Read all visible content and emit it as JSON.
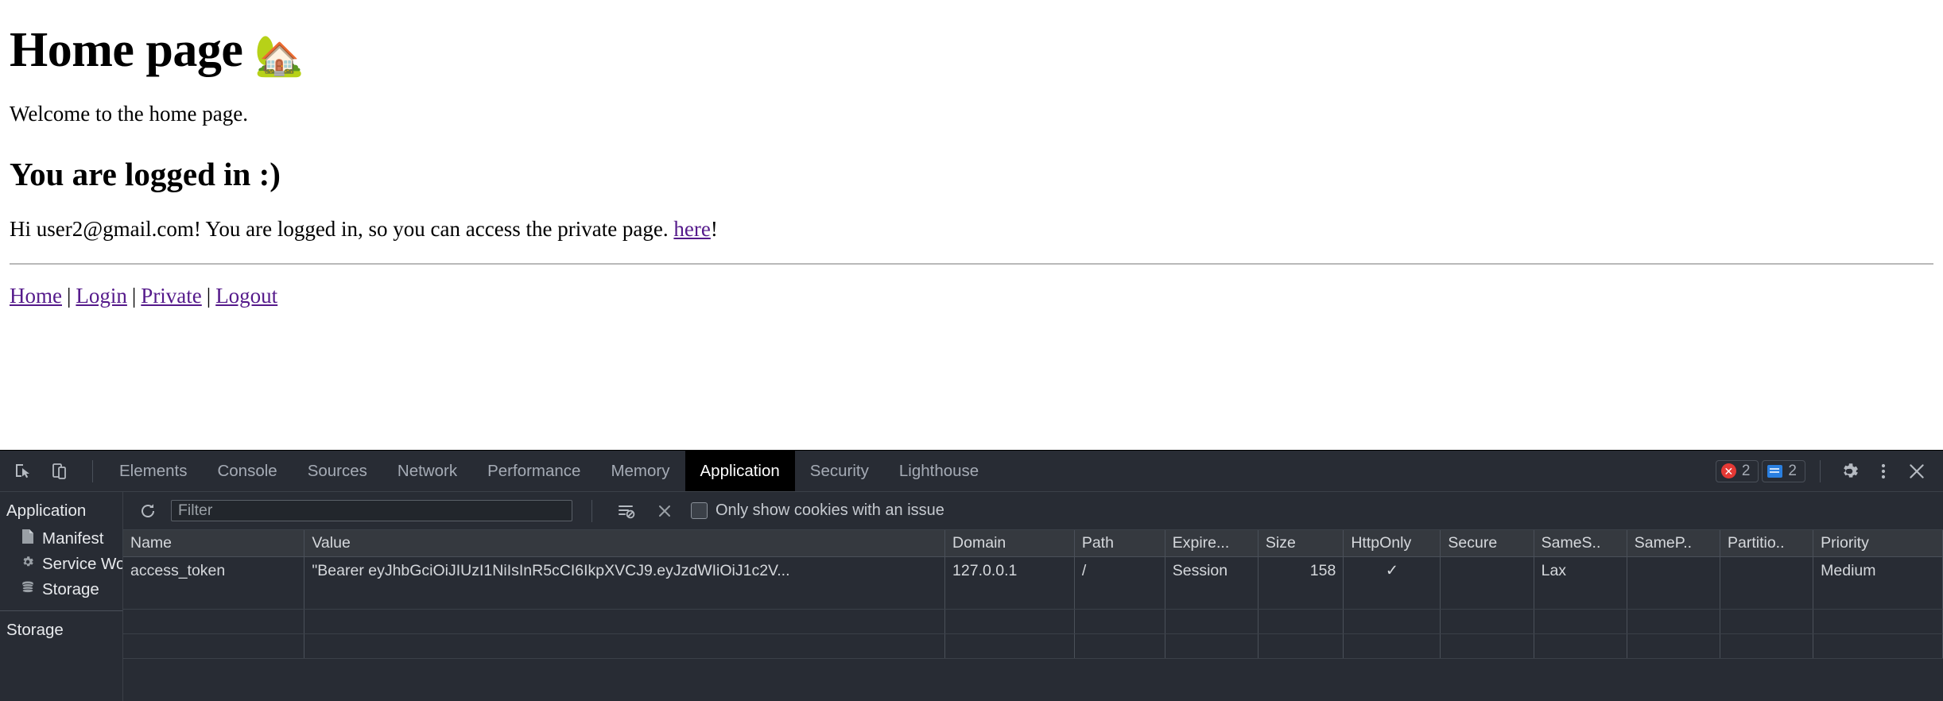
{
  "page": {
    "title": "Home page",
    "title_emoji": "🏡",
    "welcome": "Welcome to the home page.",
    "subtitle": "You are logged in :)",
    "status_prefix": "Hi user2@gmail.com! You are logged in, so you can access the private page. ",
    "status_link": "here",
    "status_suffix": "!",
    "nav": [
      {
        "label": "Home"
      },
      {
        "label": "Login"
      },
      {
        "label": "Private"
      },
      {
        "label": "Logout"
      }
    ],
    "nav_separator": "|",
    "link_color": "#551a8b"
  },
  "devtools": {
    "inspect_icon": "inspect-element-icon",
    "device_icon": "device-toolbar-icon",
    "tabs": [
      {
        "label": "Elements",
        "active": false
      },
      {
        "label": "Console",
        "active": false
      },
      {
        "label": "Sources",
        "active": false
      },
      {
        "label": "Network",
        "active": false
      },
      {
        "label": "Performance",
        "active": false
      },
      {
        "label": "Memory",
        "active": false
      },
      {
        "label": "Application",
        "active": true
      },
      {
        "label": "Security",
        "active": false
      },
      {
        "label": "Lighthouse",
        "active": false
      }
    ],
    "errors_count": "2",
    "messages_count": "2",
    "settings_icon": "gear-icon",
    "more_icon": "kebab-menu-icon",
    "close_icon": "close-icon",
    "error_color": "#e53935",
    "message_color": "#2a7fe0",
    "sidebar": {
      "application_header": "Application",
      "items": [
        {
          "label": "Manifest",
          "icon": "document-icon"
        },
        {
          "label": "Service Worker",
          "icon": "gear-icon"
        },
        {
          "label": "Storage",
          "icon": "database-icon"
        }
      ],
      "storage_header": "Storage"
    },
    "toolbar": {
      "refresh_icon": "refresh-icon",
      "filter_placeholder": "Filter",
      "filter_value": "",
      "clear_filtered_icon": "clear-filtered-cookies-icon",
      "delete_icon": "delete-cookie-icon",
      "issue_checkbox_label": "Only show cookies with an issue",
      "issue_checkbox_checked": false
    },
    "table": {
      "columns": [
        "Name",
        "Value",
        "Domain",
        "Path",
        "Expire...",
        "Size",
        "HttpOnly",
        "Secure",
        "SameS..",
        "SameP..",
        "Partitio..",
        "Priority"
      ],
      "rows": [
        {
          "name": "access_token",
          "value": "\"Bearer eyJhbGciOiJIUzI1NiIsInR5cCI6IkpXVCJ9.eyJzdWIiOiJ1c2V...",
          "domain": "127.0.0.1",
          "path": "/",
          "expires": "Session",
          "size": "158",
          "http_only": "✓",
          "secure": "",
          "same_site": "Lax",
          "same_party": "",
          "partition_key": "",
          "priority": "Medium"
        }
      ]
    }
  }
}
